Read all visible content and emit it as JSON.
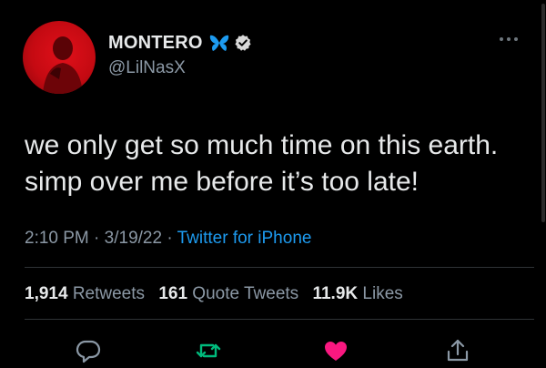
{
  "author": {
    "display_name": "MONTERO",
    "handle": "@LilNasX",
    "avatar_icon": "profile-avatar",
    "badges": [
      "butterfly-icon",
      "verified-badge-icon"
    ]
  },
  "tweet": {
    "text": "we only get so much time on this earth. simp over me before it’s too late!",
    "time": "2:10 PM",
    "separator": "·",
    "date": "3/19/22",
    "source": "Twitter for iPhone"
  },
  "stats": {
    "retweets_count": "1,914",
    "retweets_label": "Retweets",
    "quote_tweets_count": "161",
    "quote_tweets_label": "Quote Tweets",
    "likes_count": "11.9K",
    "likes_label": "Likes"
  },
  "actions": [
    "reply-icon",
    "retweet-icon",
    "like-icon",
    "share-icon"
  ],
  "colors": {
    "background": "#000000",
    "text_primary": "#e7e9ea",
    "text_secondary": "#8b98a5",
    "link": "#1d9bf0",
    "retweet_green": "#00ba7c",
    "like_pink": "#f91880",
    "avatar_red": "#e0101a"
  }
}
